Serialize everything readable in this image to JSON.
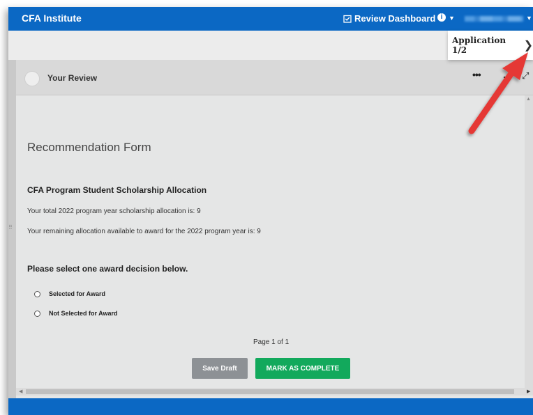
{
  "header": {
    "brand": "CFA Institute",
    "review_dashboard": "Review Dashboard",
    "info_icon": "i"
  },
  "nav": {
    "application_label": "Application 1/2",
    "next_icon": "chevron-right-icon"
  },
  "panel": {
    "title": "Your Review"
  },
  "form": {
    "heading": "Recommendation Form",
    "section_title": "CFA Program Student Scholarship Allocation",
    "line1": "Your total 2022 program year scholarship allocation is:   9",
    "line2": "Your remaining allocation available to award for the 2022 program year is:   9",
    "question": "Please select one award decision below.",
    "options": [
      "Selected for Award",
      "Not Selected for Award"
    ],
    "page_info": "Page 1 of 1",
    "save_draft": "Save Draft",
    "mark_complete": "MARK AS COMPLETE"
  },
  "colors": {
    "header_blue": "#0b68c4",
    "complete_green": "#12a95c",
    "draft_gray": "#8d9195",
    "annotation_red": "#e53935"
  }
}
